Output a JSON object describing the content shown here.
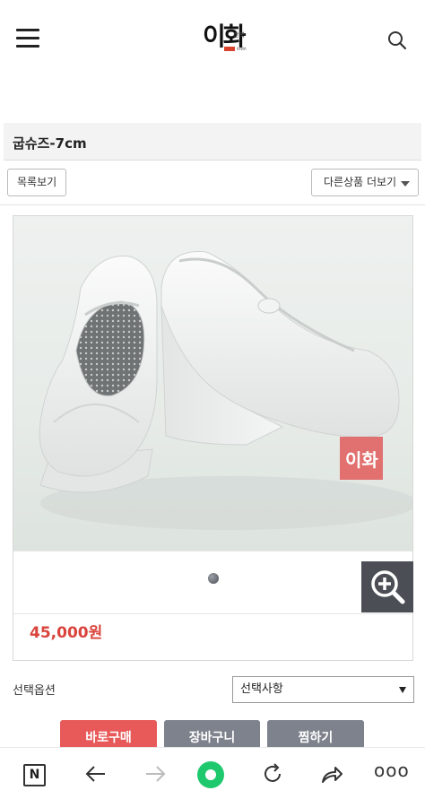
{
  "header": {
    "logo_text": "이화",
    "logo_sub": "한복",
    "logo_tiny": "IHWA",
    "menu_icon": "hamburger-menu-icon",
    "search_icon": "search-icon"
  },
  "product": {
    "title": "굽슈즈-7cm",
    "price": "45,000원",
    "watermark_text": "이화"
  },
  "nav_buttons": {
    "list_label": "목록보기",
    "more_products_label": "다른상품 더보기"
  },
  "gallery": {
    "zoom_icon": "zoom-in-icon",
    "slide_count": 1,
    "active_slide": 1
  },
  "options": {
    "label": "선택옵션",
    "selected": "선택사항"
  },
  "actions": {
    "buy_label": "바로구매",
    "cart_label": "장바구니",
    "wish_label": "찜하기"
  },
  "browser_bar": {
    "n_label": "N",
    "more_label": "ooo",
    "icons": [
      "naver-n-icon",
      "back-arrow-icon",
      "forward-arrow-icon",
      "home-green-icon",
      "refresh-icon",
      "share-arrow-icon",
      "more-dots-icon"
    ]
  },
  "colors": {
    "price": "#d9433b",
    "buy_button": "#e85a5a",
    "cart_button": "#7d828c",
    "wish_button": "#7d828c",
    "home_button": "#1ec96d",
    "zoom_button": "#4b4f55"
  }
}
